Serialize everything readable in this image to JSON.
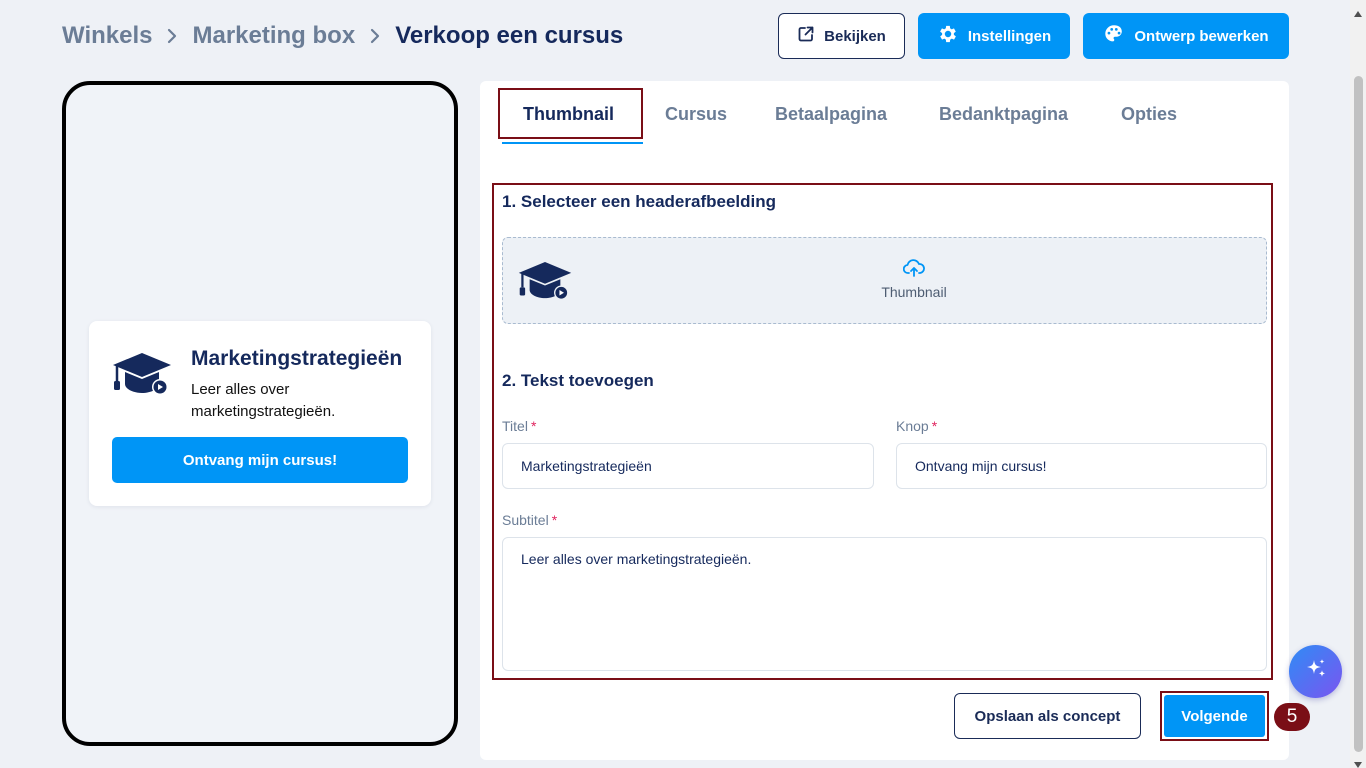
{
  "breadcrumb": {
    "items": [
      "Winkels",
      "Marketing box"
    ],
    "current": "Verkoop een cursus"
  },
  "toolbar": {
    "view_label": "Bekijken",
    "settings_label": "Instellingen",
    "design_label": "Ontwerp bewerken"
  },
  "preview": {
    "title": "Marketingstrategieën",
    "subtitle": "Leer alles over marketingstrategieën.",
    "button": "Ontvang mijn cursus!"
  },
  "tabs": [
    {
      "label": "Thumbnail",
      "active": true
    },
    {
      "label": "Cursus"
    },
    {
      "label": "Betaalpagina"
    },
    {
      "label": "Bedanktpagina"
    },
    {
      "label": "Opties"
    }
  ],
  "form": {
    "section1_title": "1. Selecteer een headerafbeelding",
    "upload_label": "Thumbnail",
    "section2_title": "2. Tekst toevoegen",
    "title_label": "Titel",
    "title_value": "Marketingstrategieën",
    "button_label": "Knop",
    "button_value": "Ontvang mijn cursus!",
    "subtitle_label": "Subtitel",
    "subtitle_value": "Leer alles over marketingstrategieën.",
    "required_mark": "*"
  },
  "footer": {
    "draft_label": "Opslaan als concept",
    "next_label": "Volgende",
    "step_number": "5"
  },
  "colors": {
    "primary": "#0095f6",
    "navy": "#15295c",
    "highlight": "#7a0e16",
    "required": "#e0245e"
  },
  "icons": {
    "course": "graduation-cap-icon",
    "upload": "cloud-upload-icon",
    "view": "external-link-icon",
    "settings": "gear-icon",
    "design": "palette-icon",
    "ai": "sparkles-icon"
  }
}
